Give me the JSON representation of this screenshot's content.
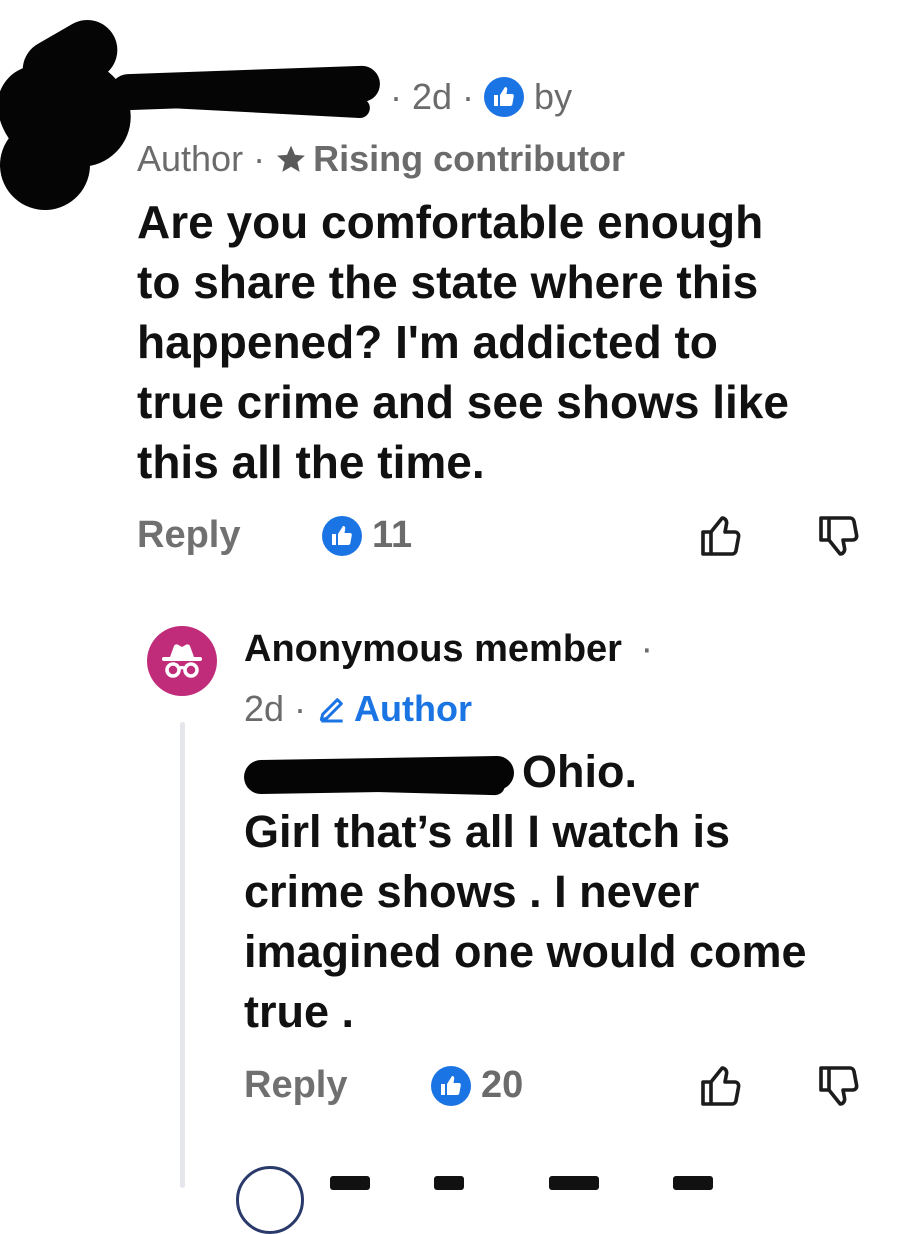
{
  "comment": {
    "age": "2d",
    "by_label": "by",
    "role": "Author",
    "badge": "Rising contributor",
    "text_lines": [
      "Are you comfortable enough",
      "to share the state where this",
      "happened? I'm addicted to",
      "true crime and see shows like",
      "this all the time."
    ],
    "reply_label": "Reply",
    "like_count": "11"
  },
  "reply": {
    "author_name": "Anonymous member",
    "age": "2d",
    "role": "Author",
    "first_line_visible": "Ohio.",
    "text_lines": [
      "Girl that’s all I watch is",
      "crime shows . I never",
      "imagined one would come",
      "true ."
    ],
    "reply_label": "Reply",
    "like_count": "20"
  },
  "colors": {
    "accent_blue": "#1b74e4",
    "avatar_pink": "#c02c7a",
    "muted_text": "#6b6b6b"
  },
  "icons": {
    "like": "thumbs-up-icon",
    "dislike": "thumbs-down-icon",
    "star": "star-icon",
    "pencil": "pencil-icon",
    "anonymous": "incognito-icon"
  }
}
